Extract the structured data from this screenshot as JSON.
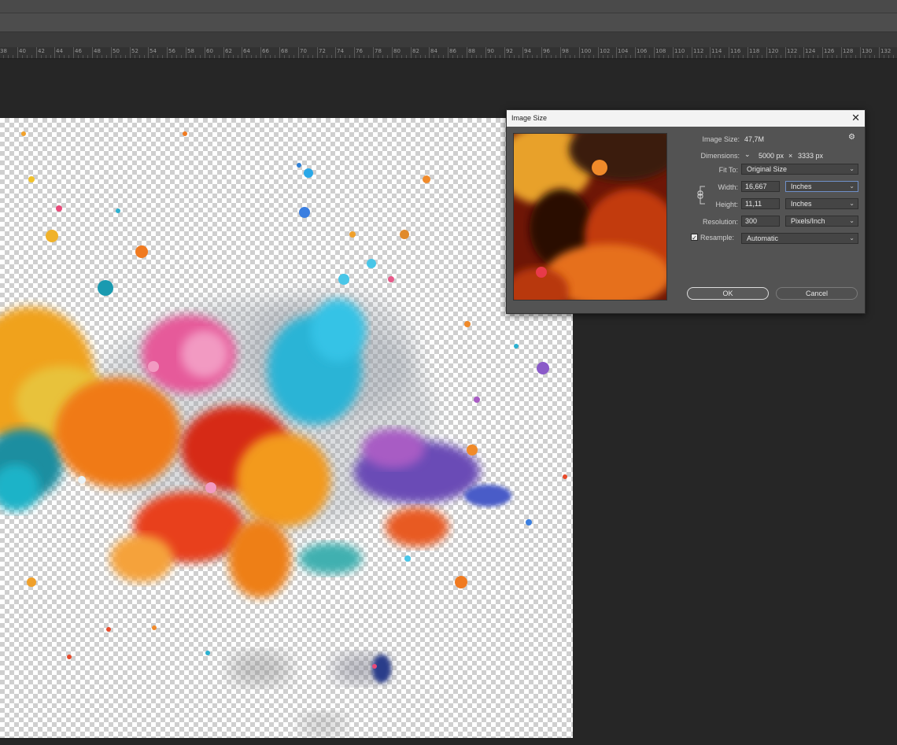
{
  "ruler": {
    "labels": [
      "38",
      "40",
      "42",
      "44",
      "46",
      "48",
      "50",
      "52",
      "54",
      "56",
      "58",
      "60",
      "62",
      "64",
      "66",
      "68",
      "70",
      "72",
      "74",
      "76",
      "78",
      "80",
      "82",
      "84",
      "86",
      "88",
      "90",
      "92",
      "94",
      "96",
      "98",
      "100",
      "102",
      "104",
      "106",
      "108",
      "110",
      "112",
      "114",
      "116",
      "118",
      "120",
      "122",
      "124",
      "126",
      "128",
      "130",
      "132"
    ]
  },
  "dialog": {
    "title": "Image Size",
    "image_size_label": "Image Size:",
    "image_size_value": "47,7M",
    "dimensions_label": "Dimensions:",
    "dimensions_width": "5000 px",
    "dimensions_sep": "×",
    "dimensions_height": "3333 px",
    "fit_to_label": "Fit To:",
    "fit_to_value": "Original Size",
    "width_label": "Width:",
    "width_value": "16,667",
    "width_unit": "Inches",
    "height_label": "Height:",
    "height_value": "11,11",
    "height_unit": "Inches",
    "resolution_label": "Resolution:",
    "resolution_value": "300",
    "resolution_unit": "Pixels/Inch",
    "resample_label": "Resample:",
    "resample_checked": true,
    "resample_value": "Automatic",
    "ok_label": "OK",
    "cancel_label": "Cancel"
  },
  "icons": {
    "close": "close-icon",
    "gear": "gear-icon",
    "chevron": "chevron-down-icon",
    "link": "chain-link-icon",
    "check": "checkmark-icon"
  },
  "colors": {
    "background": "#262626",
    "dialog": "#535353",
    "titlebar": "#f3f3f3"
  }
}
